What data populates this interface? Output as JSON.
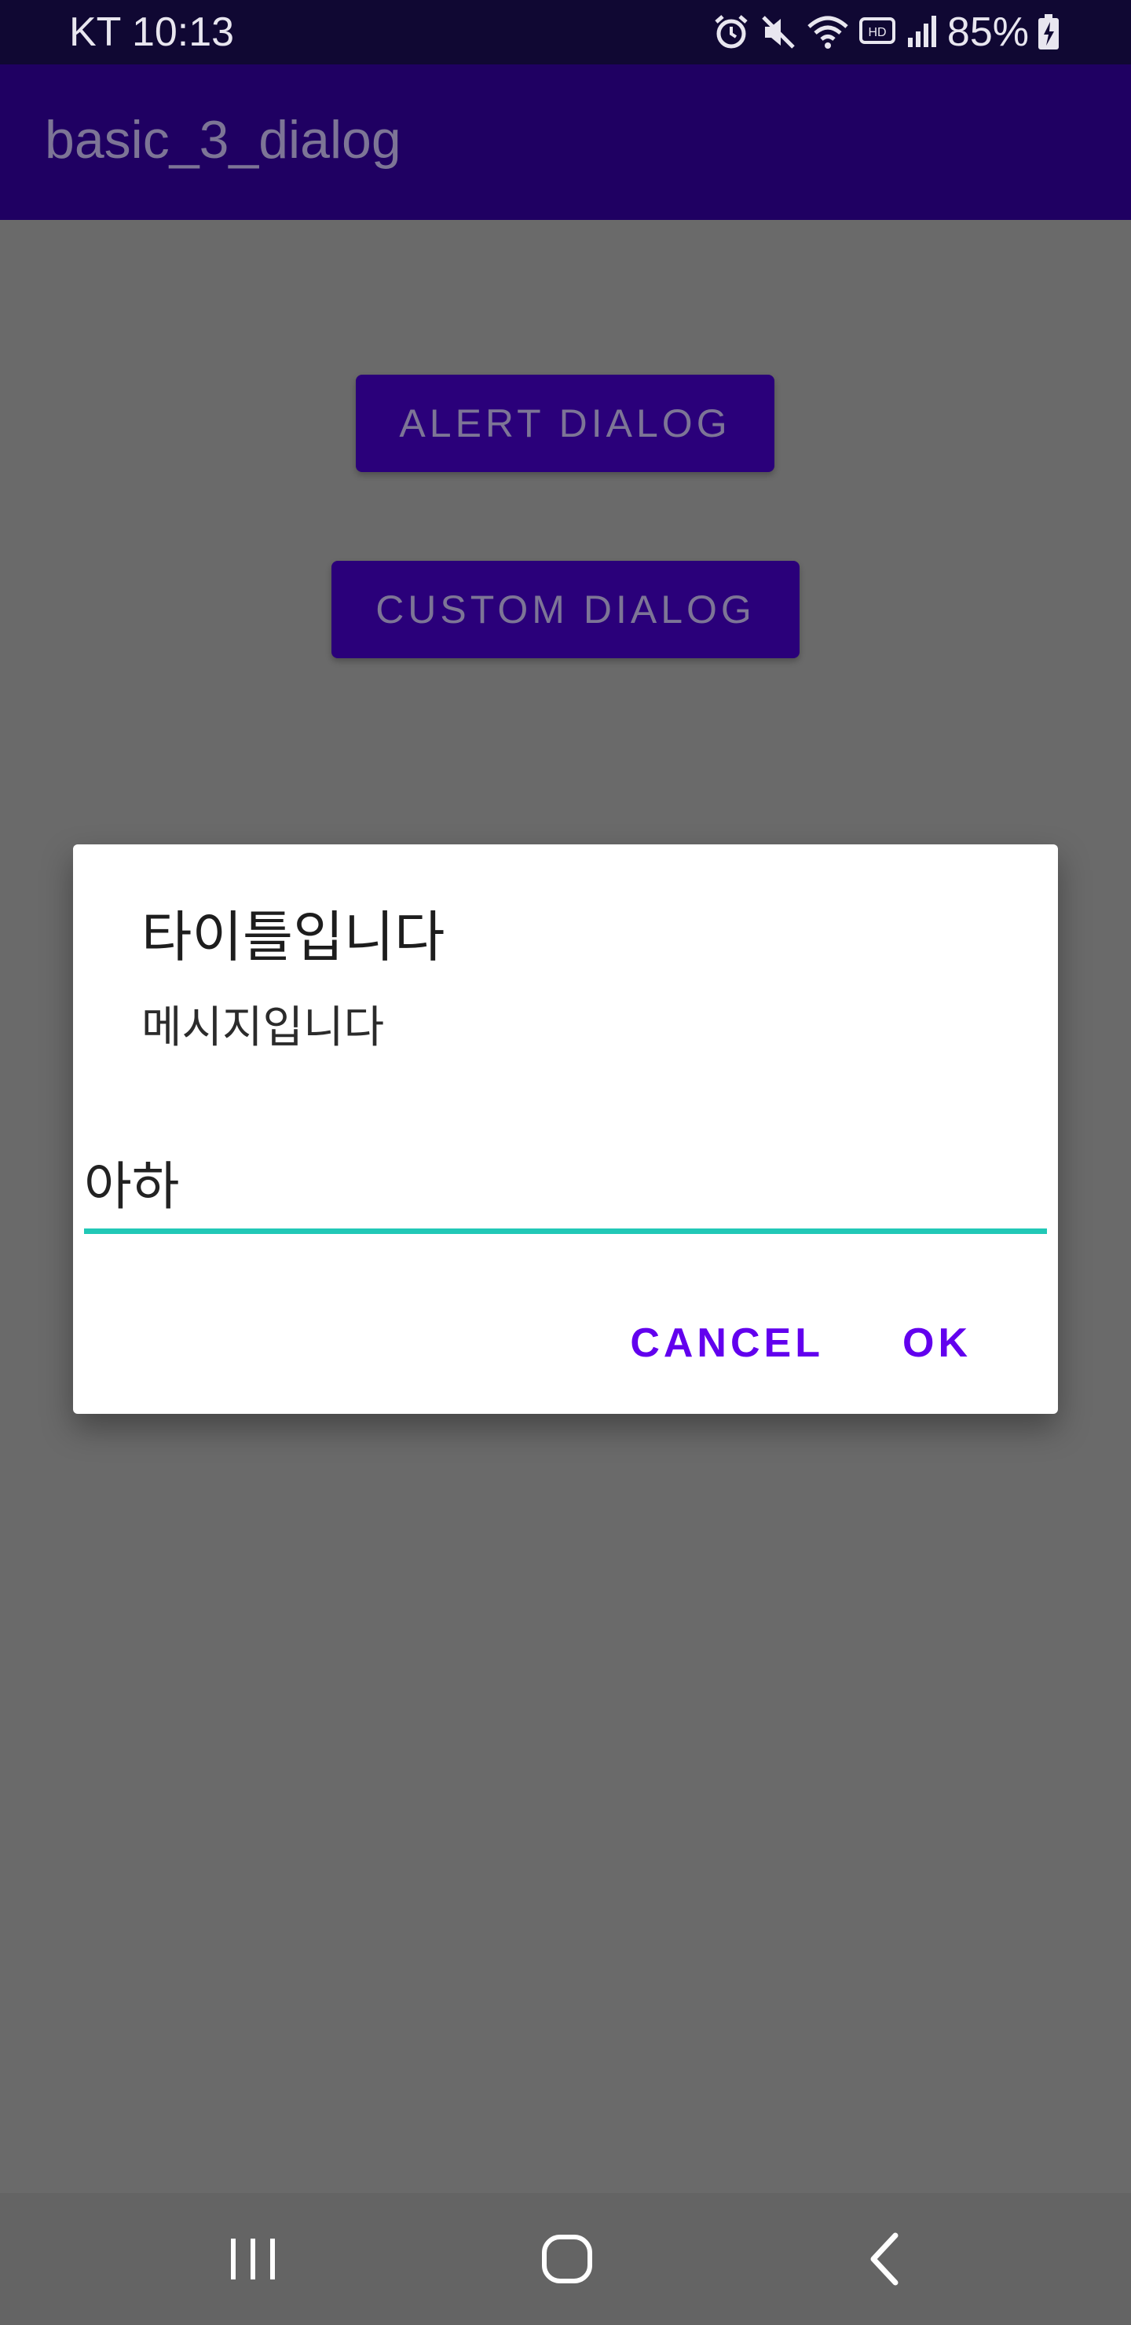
{
  "status_bar": {
    "carrier_time": "KT 10:13",
    "battery_percent": "85%",
    "icons": [
      "alarm-icon",
      "mute-icon",
      "wifi-icon",
      "hd-voice-icon",
      "signal-icon",
      "battery-charging-icon"
    ]
  },
  "app_bar": {
    "title": "basic_3_dialog"
  },
  "buttons": {
    "alert_dialog": "ALERT DIALOG",
    "custom_dialog": "CUSTOM DIALOG"
  },
  "dialog": {
    "title": "타이틀입니다",
    "message": "메시지입니다",
    "input_value": "아하",
    "cancel_label": "CANCEL",
    "ok_label": "OK"
  },
  "nav_bar": {
    "icons": [
      "recents-icon",
      "home-icon",
      "back-icon"
    ]
  },
  "colors": {
    "status_bar": "#100833",
    "app_bar": "#1f0062",
    "button": "#2a007a",
    "scrim_background": "#6a6a6a",
    "accent_text": "#6200ee",
    "input_underline": "#21c8b6"
  }
}
